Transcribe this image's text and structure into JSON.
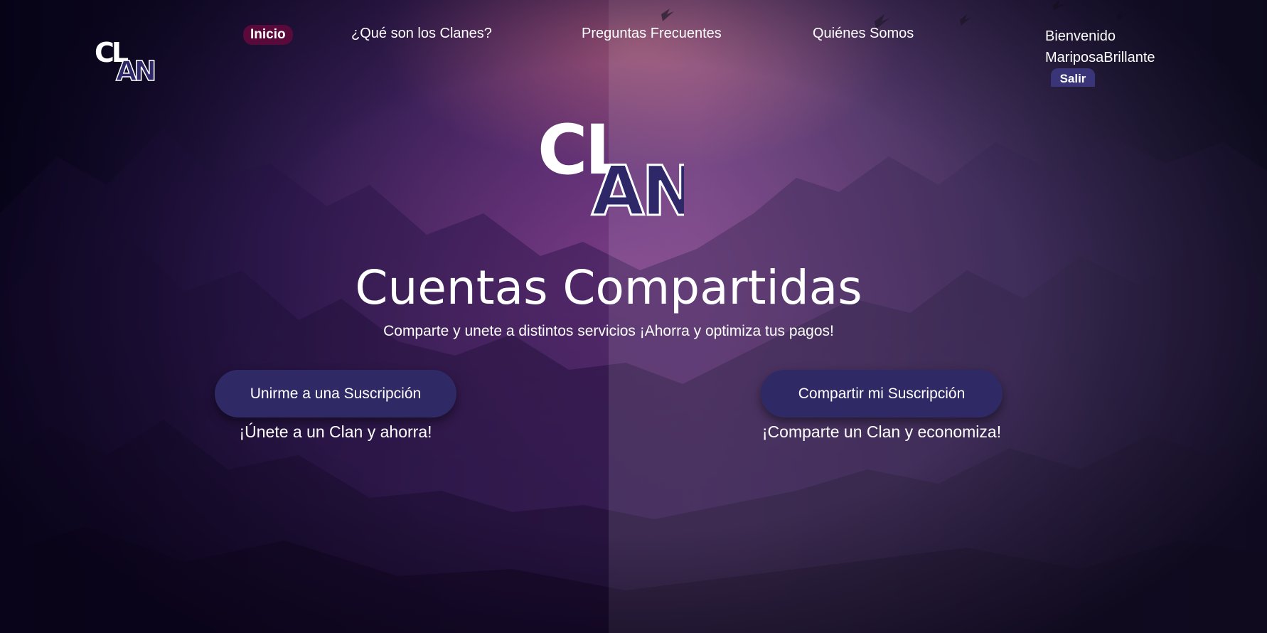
{
  "brand": {
    "logo_top": "CL",
    "logo_bottom": "AN"
  },
  "nav": {
    "active_label": "Inicio",
    "items": [
      {
        "label": "¿Qué son los Clanes?"
      },
      {
        "label": "Preguntas Frecuentes"
      },
      {
        "label": "Quiénes Somos"
      }
    ]
  },
  "user": {
    "greeting": "Bienvenido",
    "username": "MariposaBrillante",
    "logout_label": "Salir"
  },
  "hero": {
    "title": "Cuentas Compartidas",
    "subtitle": "Comparte y unete a distintos servicios ¡Ahorra y optimiza tus pagos!"
  },
  "actions": {
    "join": {
      "label": "Unirme a una Suscripción",
      "caption": "¡Únete a un Clan y ahorra!"
    },
    "share": {
      "label": "Compartir mi Suscripción",
      "caption": "¡Comparte un Clan y economiza!"
    }
  },
  "colors": {
    "button_bg": "#2f2a66",
    "active_nav_bg": "#5a0a3a",
    "logout_bg": "#3a3478",
    "logo_an_fill": "#2e2868"
  }
}
